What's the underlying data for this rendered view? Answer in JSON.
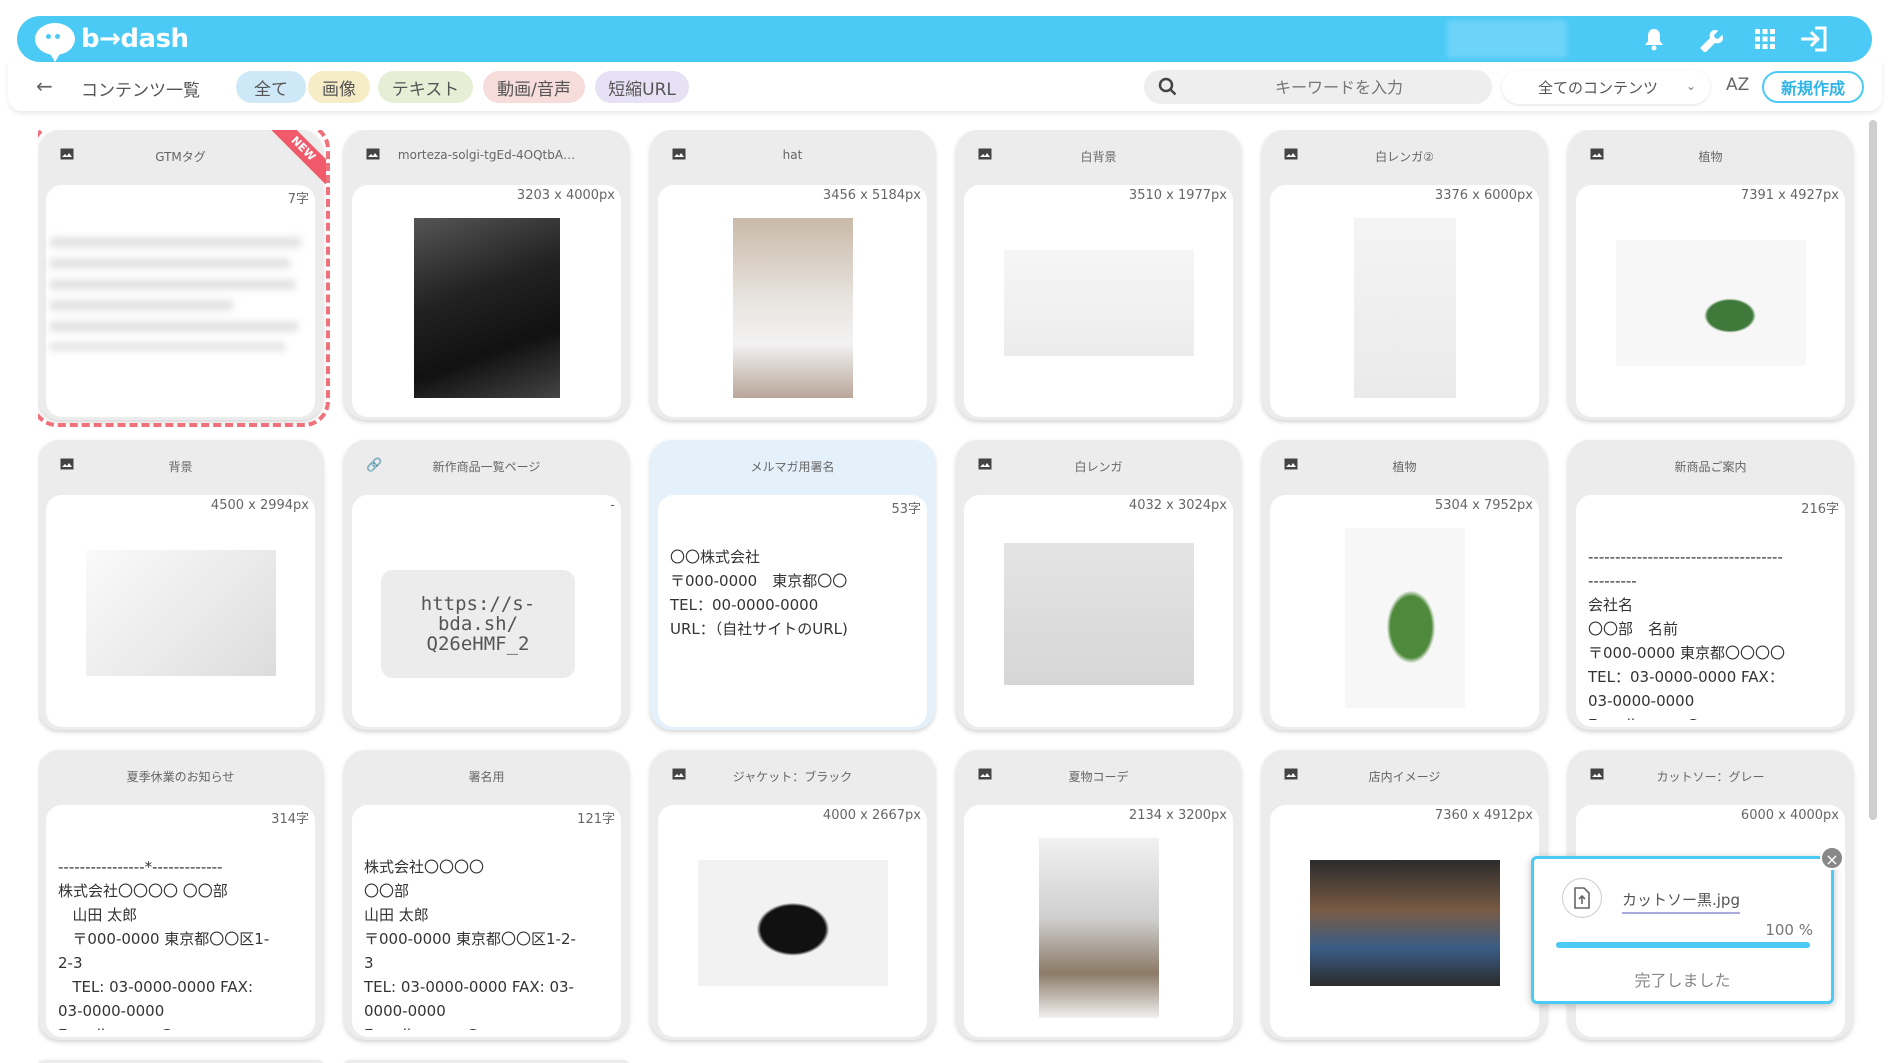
{
  "app": {
    "logo_text": "b→dash"
  },
  "toolbar": {
    "back": "←",
    "title": "コンテンツ一覧",
    "filters": [
      {
        "label": "全て",
        "color": "#cfe8f7"
      },
      {
        "label": "画像",
        "color": "#f6ecc6"
      },
      {
        "label": "テキスト",
        "color": "#e6efd6"
      },
      {
        "label": "動画/音声",
        "color": "#f7dcdc"
      },
      {
        "label": "短縮URL",
        "color": "#e7e1f5"
      }
    ],
    "search_placeholder": "キーワードを入力",
    "select_value": "全てのコンテンツ",
    "sort_label": "AZ",
    "new_button": "新規作成"
  },
  "cards": [
    {
      "title": "GTMタグ",
      "meta": "7字",
      "kind": "code",
      "badge": "NEW"
    },
    {
      "title": "morteza-solgi-tgEd-4OQtbA…",
      "meta": "3203 x 4000px",
      "kind": "image"
    },
    {
      "title": "hat",
      "meta": "3456 x 5184px",
      "kind": "image"
    },
    {
      "title": "白背景",
      "meta": "3510 x 1977px",
      "kind": "image"
    },
    {
      "title": "白レンガ②",
      "meta": "3376 x 6000px",
      "kind": "image"
    },
    {
      "title": "植物",
      "meta": "7391 x 4927px",
      "kind": "image"
    },
    {
      "title": "背景",
      "meta": "4500 x 2994px",
      "kind": "image"
    },
    {
      "title": "新作商品一覧ページ",
      "meta": "-",
      "kind": "url",
      "url": "https://s-bda.sh/\nQ26eHMF_2"
    },
    {
      "title": "メルマガ用署名",
      "meta": "53字",
      "kind": "text",
      "text": "〇〇株式会社\n〒000-0000　東京都〇〇\nTEL：00-0000-0000\nURL：（自社サイトのURL)"
    },
    {
      "title": "白レンガ",
      "meta": "4032 x 3024px",
      "kind": "image"
    },
    {
      "title": "植物",
      "meta": "5304 x 7952px",
      "kind": "image"
    },
    {
      "title": "新商品ご案内",
      "meta": "216字",
      "kind": "text",
      "text": "------------------------------------\n---------\n会社名\n〇〇部　名前\n〒000-0000 東京都〇〇〇〇\nTEL：03-0000-0000 FAX：\n03-0000-0000\nE-mail：xxxx@xxxx"
    },
    {
      "title": "夏季休業のお知らせ",
      "meta": "314字",
      "kind": "text",
      "text": "----------------*-------------\n株式会社〇〇〇〇 〇〇部\n   山田 太郎\n   〒000-0000 東京都〇〇区1-\n2-3\n   TEL: 03-0000-0000 FAX:\n03-0000-0000\nE-mail: xxxxx@xxxx"
    },
    {
      "title": "署名用",
      "meta": "121字",
      "kind": "text",
      "text": "株式会社〇〇〇〇\n〇〇部\n山田 太郎\n〒000-0000 東京都〇〇区1-2-\n3\nTEL: 03-0000-0000 FAX: 03-\n0000-0000\nE-mail: xxxxx@xxxx"
    },
    {
      "title": "ジャケット：ブラック",
      "meta": "4000 x 2667px",
      "kind": "image"
    },
    {
      "title": "夏物コーデ",
      "meta": "2134 x 3200px",
      "kind": "image"
    },
    {
      "title": "店内イメージ",
      "meta": "7360 x 4912px",
      "kind": "image"
    },
    {
      "title": "カットソー：グレー",
      "meta": "6000 x 4000px",
      "kind": "image"
    }
  ],
  "upload": {
    "file_name": "カットソー黒.jpg",
    "progress_text": "100 %",
    "progress": 1.0,
    "status": "完了しました"
  }
}
